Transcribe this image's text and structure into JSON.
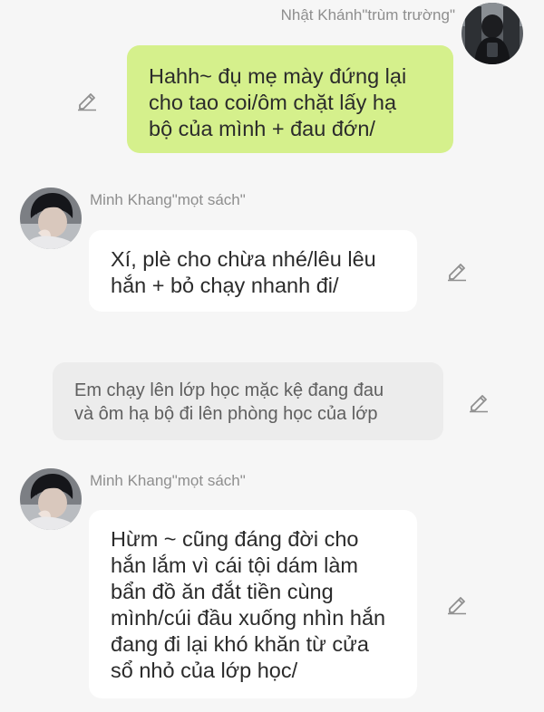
{
  "messages": [
    {
      "sender": "Nhật Khánh\"trùm trường\"",
      "side": "right",
      "type": "bubble",
      "lines": [
        "Hahh~ đụ mẹ mày đứng lại",
        "cho tao coi/ôm chặt lấy hạ",
        "bộ của mình + đau đớn/"
      ],
      "edit_icon": "pencil-icon"
    },
    {
      "sender": "Minh Khang\"mọt sách\"",
      "side": "left",
      "type": "bubble",
      "lines": [
        "Xí, plè cho chừa nhé/lêu lêu",
        "hắn + bỏ chạy nhanh đi/"
      ],
      "edit_icon": "pencil-icon"
    },
    {
      "type": "narration",
      "lines": [
        "Em chạy lên lớp học mặc kệ đang đau",
        "và ôm hạ bộ đi lên phòng học của lớp"
      ],
      "edit_icon": "pencil-icon"
    },
    {
      "sender": "Minh Khang\"mọt sách\"",
      "side": "left",
      "type": "bubble",
      "lines": [
        "Hừm ~ cũng đáng đời cho",
        "hắn lắm vì cái tội dám làm",
        "bẩn đồ ăn đắt tiền cùng",
        "mình/cúi đầu xuống nhìn hắn",
        "đang đi lại khó khăn từ cửa",
        "sổ nhỏ của lớp học/"
      ],
      "edit_icon": "pencil-icon"
    }
  ],
  "colors": {
    "background": "#f6f6f6",
    "outgoing_bubble": "#d5f08c",
    "incoming_bubble": "#ffffff",
    "narration_bubble": "#ececec",
    "sender_name": "#8e8e8e"
  }
}
